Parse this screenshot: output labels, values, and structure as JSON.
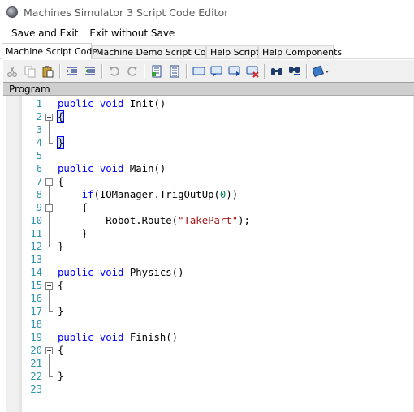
{
  "window": {
    "title": "Machines Simulator 3 Script Code Editor"
  },
  "menu": {
    "items": [
      "Save and Exit",
      "Exit without Save"
    ]
  },
  "tabs": [
    {
      "label": "Machine Script Code",
      "active": true
    },
    {
      "label": "Machine Demo Script Code",
      "active": false
    },
    {
      "label": "Help Script",
      "active": false
    },
    {
      "label": "Help Components",
      "active": false
    }
  ],
  "toolbar": {
    "buttons": [
      "cut-icon",
      "copy-icon",
      "paste-icon",
      "indent-icon",
      "outdent-icon",
      "undo-icon",
      "redo-icon",
      "bookmark-icon",
      "bookmark-list-icon",
      "comment-icon",
      "prev-bookmark-icon",
      "next-bookmark-icon",
      "clear-bookmarks-icon",
      "find-icon",
      "find-replace-icon",
      "settings-dropdown-icon"
    ]
  },
  "panel": {
    "title": "Program"
  },
  "editor": {
    "colors": {
      "keyword": "#0000ff",
      "string": "#a31515",
      "number": "#098658",
      "line_number": "#2b91af"
    },
    "lines": [
      {
        "n": "1",
        "text": "public void Init()"
      },
      {
        "n": "2",
        "text": "{"
      },
      {
        "n": "3",
        "text": ""
      },
      {
        "n": "4",
        "text": "}"
      },
      {
        "n": "5",
        "text": ""
      },
      {
        "n": "6",
        "text": "public void Main()"
      },
      {
        "n": "7",
        "text": "{"
      },
      {
        "n": "8",
        "text": "    if(IOManager.TrigOutUp(0))"
      },
      {
        "n": "9",
        "text": "    {"
      },
      {
        "n": "10",
        "text": "        Robot.Route(\"TakePart\");"
      },
      {
        "n": "11",
        "text": "    }"
      },
      {
        "n": "12",
        "text": "}"
      },
      {
        "n": "13",
        "text": ""
      },
      {
        "n": "14",
        "text": "public void Physics()"
      },
      {
        "n": "15",
        "text": "{"
      },
      {
        "n": "16",
        "text": ""
      },
      {
        "n": "17",
        "text": "}"
      },
      {
        "n": "18",
        "text": ""
      },
      {
        "n": "19",
        "text": "public void Finish()"
      },
      {
        "n": "20",
        "text": "{"
      },
      {
        "n": "21",
        "text": ""
      },
      {
        "n": "22",
        "text": "}"
      },
      {
        "n": "23",
        "text": ""
      }
    ]
  }
}
